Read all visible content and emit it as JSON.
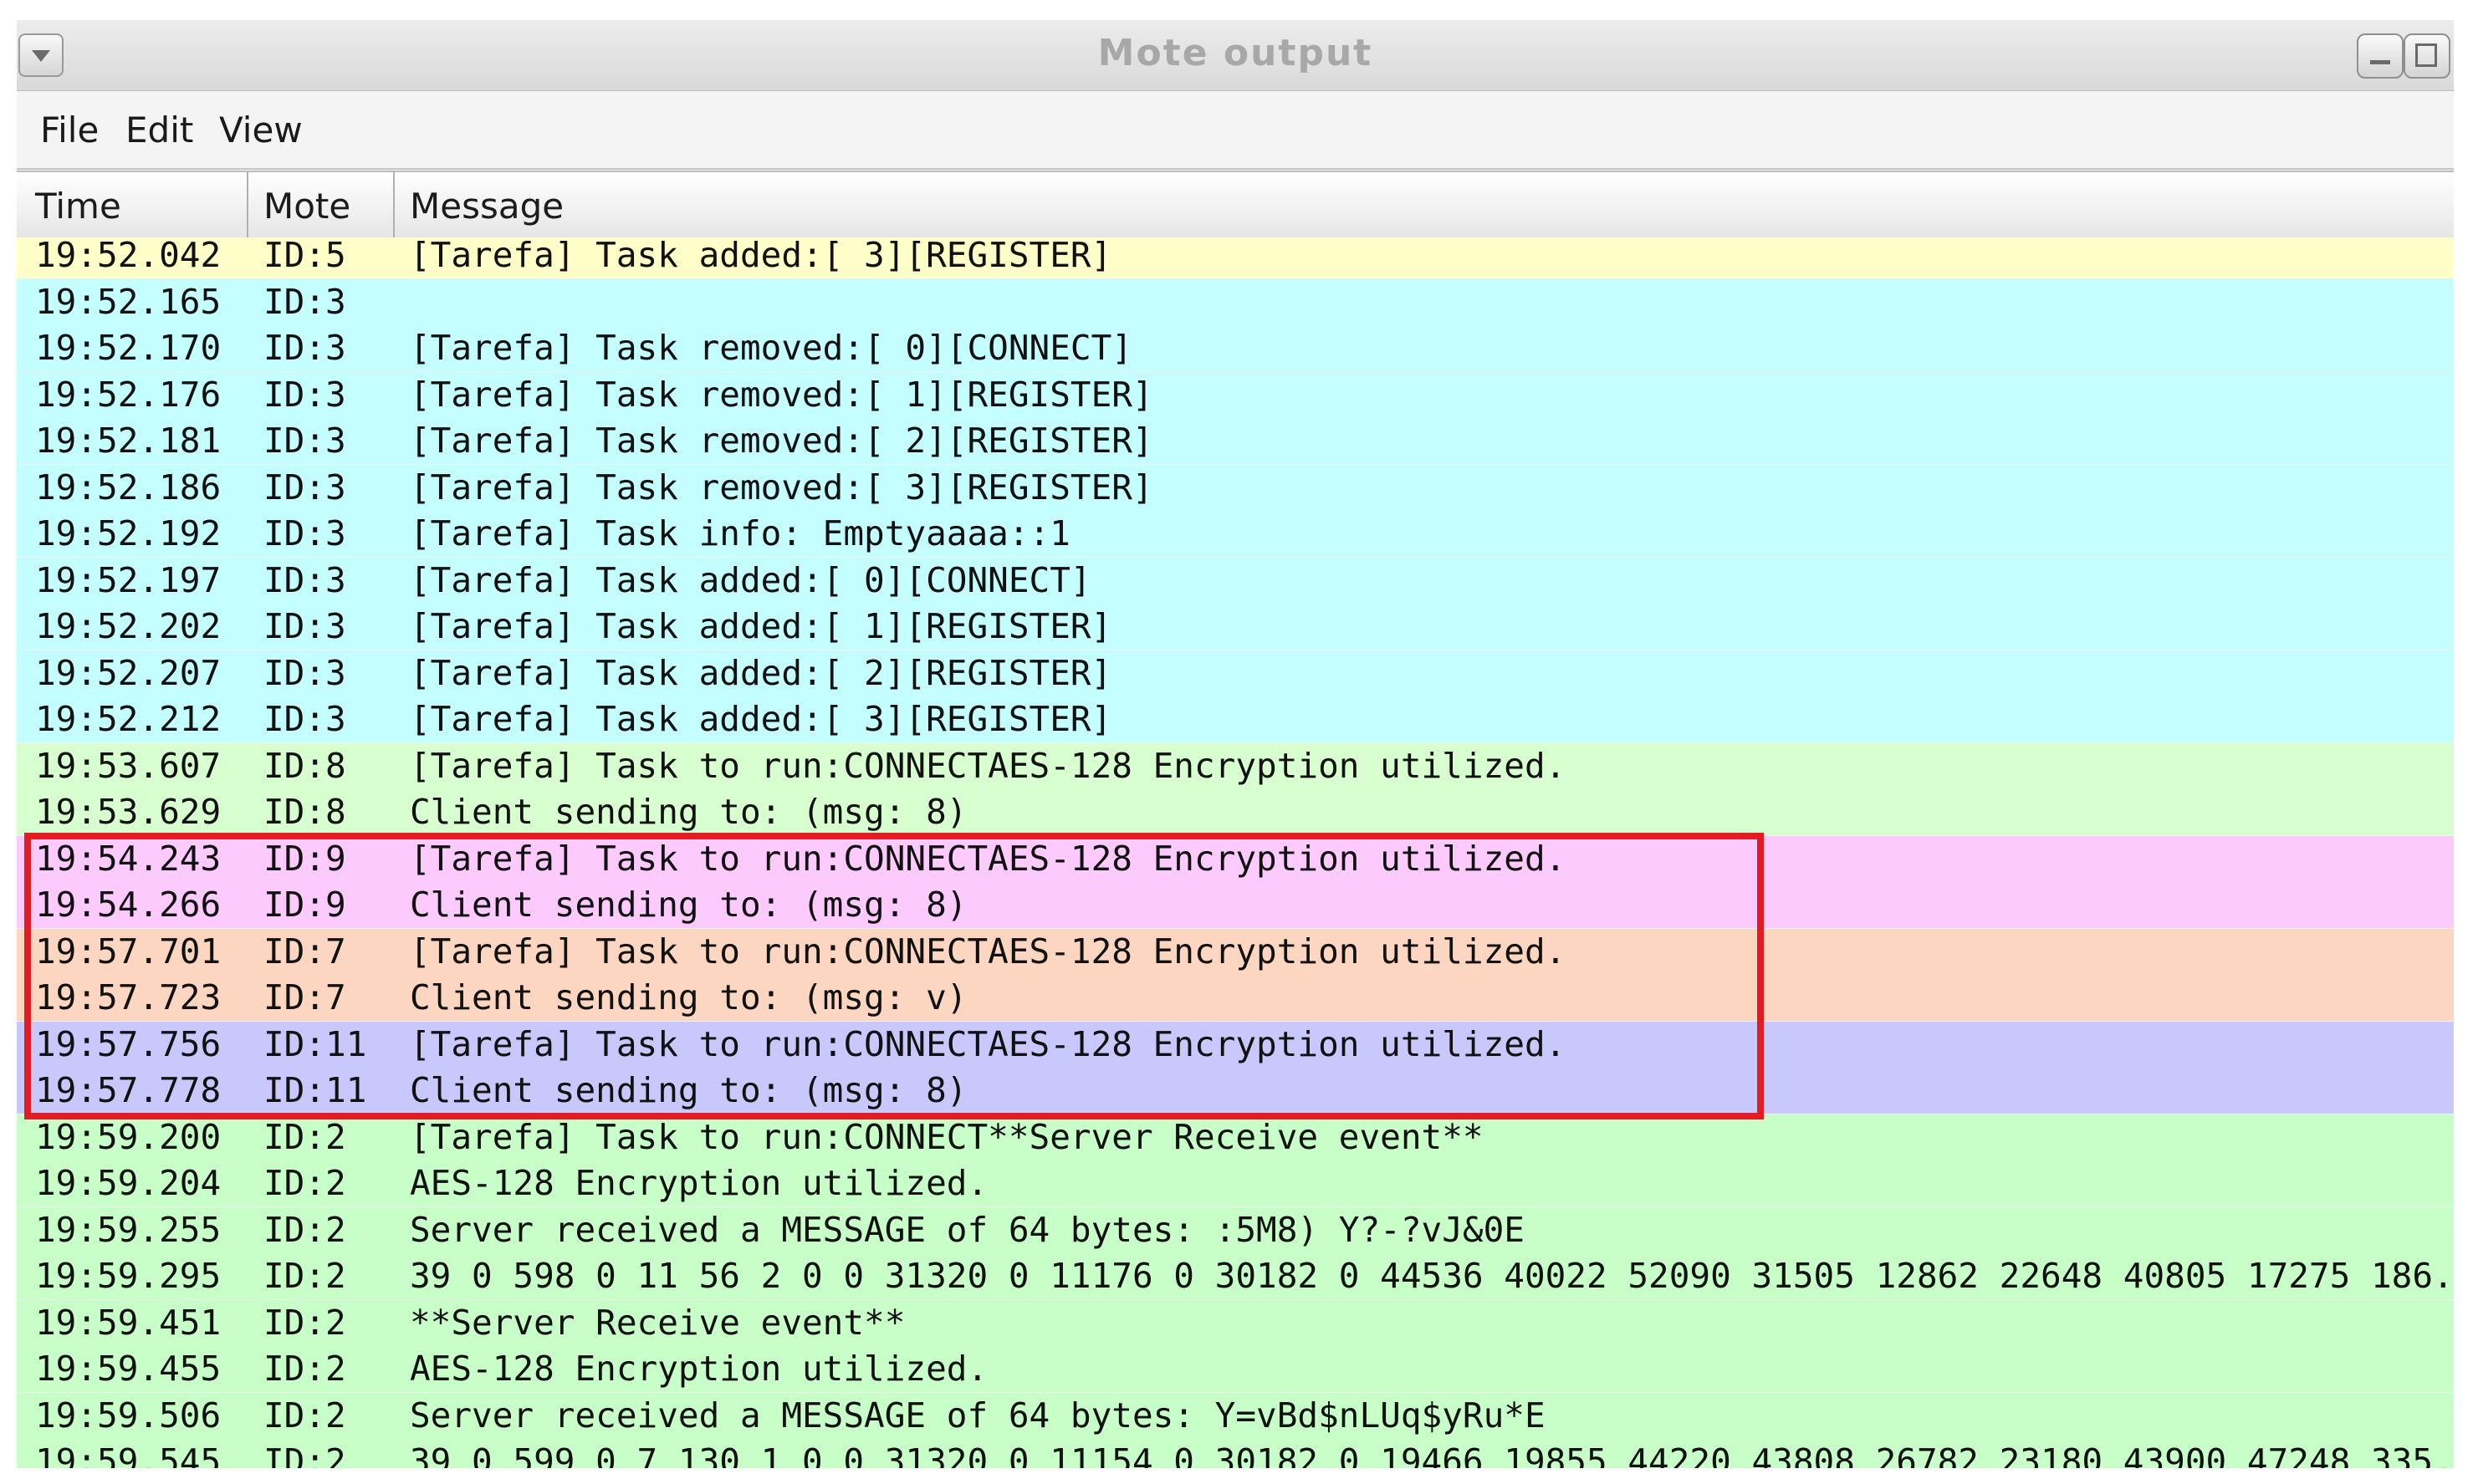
{
  "window": {
    "title": "Mote output"
  },
  "menu": [
    "File",
    "Edit",
    "View"
  ],
  "table": {
    "columns": [
      "Time",
      "Mote",
      "Message"
    ],
    "rows": [
      {
        "time": "19:52.042",
        "mote": "ID:5",
        "message": "[Tarefa] Task added:[ 3][REGISTER]",
        "color": "#fffdc8"
      },
      {
        "time": "19:52.165",
        "mote": "ID:3",
        "message": "",
        "color": "#c4fefe"
      },
      {
        "time": "19:52.170",
        "mote": "ID:3",
        "message": "[Tarefa] Task removed:[ 0][CONNECT]",
        "color": "#c4fefe"
      },
      {
        "time": "19:52.176",
        "mote": "ID:3",
        "message": "[Tarefa] Task removed:[ 1][REGISTER]",
        "color": "#c4fefe"
      },
      {
        "time": "19:52.181",
        "mote": "ID:3",
        "message": "[Tarefa] Task removed:[ 2][REGISTER]",
        "color": "#c4fefe"
      },
      {
        "time": "19:52.186",
        "mote": "ID:3",
        "message": "[Tarefa] Task removed:[ 3][REGISTER]",
        "color": "#c4fefe"
      },
      {
        "time": "19:52.192",
        "mote": "ID:3",
        "message": "[Tarefa] Task info: Emptyaaaa::1",
        "color": "#c4fefe"
      },
      {
        "time": "19:52.197",
        "mote": "ID:3",
        "message": "[Tarefa] Task added:[ 0][CONNECT]",
        "color": "#c4fefe"
      },
      {
        "time": "19:52.202",
        "mote": "ID:3",
        "message": "[Tarefa] Task added:[ 1][REGISTER]",
        "color": "#c4fefe"
      },
      {
        "time": "19:52.207",
        "mote": "ID:3",
        "message": "[Tarefa] Task added:[ 2][REGISTER]",
        "color": "#c4fefe"
      },
      {
        "time": "19:52.212",
        "mote": "ID:3",
        "message": "[Tarefa] Task added:[ 3][REGISTER]",
        "color": "#c4fefe"
      },
      {
        "time": "19:53.607",
        "mote": "ID:8",
        "message": "[Tarefa] Task to run:CONNECTAES-128 Encryption utilized.",
        "color": "#d8ffd0"
      },
      {
        "time": "19:53.629",
        "mote": "ID:8",
        "message": "Client sending to:  (msg: 8)",
        "color": "#d8ffd0"
      },
      {
        "time": "19:54.243",
        "mote": "ID:9",
        "message": "[Tarefa] Task to run:CONNECTAES-128 Encryption utilized.",
        "color": "#fdcafe"
      },
      {
        "time": "19:54.266",
        "mote": "ID:9",
        "message": "Client sending to:  (msg: 8)",
        "color": "#fdcafe"
      },
      {
        "time": "19:57.701",
        "mote": "ID:7",
        "message": "[Tarefa] Task to run:CONNECTAES-128 Encryption utilized.",
        "color": "#fcd6c0"
      },
      {
        "time": "19:57.723",
        "mote": "ID:7",
        "message": "Client sending to:  (msg: v)",
        "color": "#fcd6c0"
      },
      {
        "time": "19:57.756",
        "mote": "ID:11",
        "message": "[Tarefa] Task to run:CONNECTAES-128 Encryption utilized.",
        "color": "#c8c8fc"
      },
      {
        "time": "19:57.778",
        "mote": "ID:11",
        "message": "Client sending to:  (msg: 8)",
        "color": "#c8c8fc"
      },
      {
        "time": "19:59.200",
        "mote": "ID:2",
        "message": "[Tarefa] Task to run:CONNECT**Server Receive event**",
        "color": "#c8fec8"
      },
      {
        "time": "19:59.204",
        "mote": "ID:2",
        "message": "AES-128 Encryption utilized.",
        "color": "#c8fec8"
      },
      {
        "time": "19:59.255",
        "mote": "ID:2",
        "message": "Server received a MESSAGE of 64 bytes: :5M8) Y?-?vJ&0E",
        "color": "#c8fec8"
      },
      {
        "time": "19:59.295",
        "mote": "ID:2",
        "message": "39 0 598 0 11 56 2 0 0 31320 0 11176 0 30182 0 44536 40022 52090 31505 12862 22648 40805 17275 186...",
        "color": "#c8fec8"
      },
      {
        "time": "19:59.451",
        "mote": "ID:2",
        "message": "**Server Receive event**",
        "color": "#c8fec8"
      },
      {
        "time": "19:59.455",
        "mote": "ID:2",
        "message": "AES-128 Encryption utilized.",
        "color": "#c8fec8"
      },
      {
        "time": "19:59.506",
        "mote": "ID:2",
        "message": "Server received a MESSAGE of 64 bytes: Y=vBd$nLUq$yRu*E",
        "color": "#c8fec8"
      },
      {
        "time": "19:59.545",
        "mote": "ID:2",
        "message": "39 0 599 0 7 130 1 0 0 31320 0 11154 0 30182 0 19466 19855 44220 43808 26782 23180 43900 47248 335...",
        "color": "#c8fec8"
      }
    ]
  },
  "highlight": {
    "color": "#e51b23"
  }
}
